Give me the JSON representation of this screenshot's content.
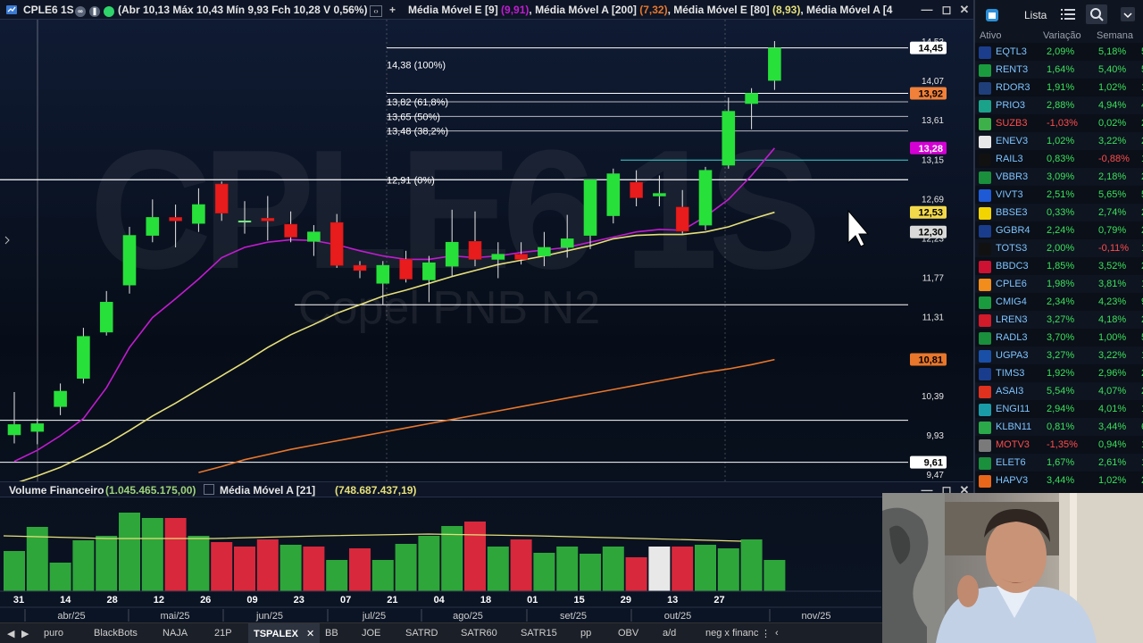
{
  "title_bar": {
    "symbol": "CPLE6 1S",
    "ohlc_text": "(Abr 10,13 Máx 10,43 Mín 9,93 Fch 10,28 V 0,56%)",
    "indicators": [
      {
        "label": "Média Móvel E [9]",
        "value": "(9,91)"
      },
      {
        "label": "Média Móvel A [200]",
        "value": "(7,32)"
      },
      {
        "label": "Média Móvel E [80]",
        "value": "(8,93)"
      },
      {
        "label": "Média Móvel A [4",
        "value": ""
      }
    ]
  },
  "watermark": {
    "ticker": "CPLE6 1S",
    "company": "Copel PNB N2"
  },
  "fibonacci": [
    {
      "label": "14,38 (100%)",
      "price": 14.38
    },
    {
      "label": "13,82 (61,8%)",
      "price": 13.82
    },
    {
      "label": "13,65 (50%)",
      "price": 13.65
    },
    {
      "label": "13,48 (38,2%)",
      "price": 13.48
    },
    {
      "label": "12,91 (0%)",
      "price": 12.91
    }
  ],
  "price_axis": {
    "ticks": [
      "14,53",
      "14,07",
      "13,61",
      "13,15",
      "12,69",
      "12,23",
      "11,77",
      "11,31",
      "10,85",
      "10,39",
      "9,93",
      "9,47"
    ],
    "tick_values": [
      14.53,
      14.07,
      13.61,
      13.15,
      12.69,
      12.23,
      11.77,
      11.31,
      10.85,
      10.39,
      9.93,
      9.47
    ],
    "tags": [
      {
        "label": "14,45",
        "value": 14.45,
        "bg": "#ffffff",
        "fg": "#000000"
      },
      {
        "label": "13,92",
        "value": 13.92,
        "bg": "#f0803a",
        "fg": "#000000"
      },
      {
        "label": "13,28",
        "value": 13.28,
        "bg": "#d400d4",
        "fg": "#ffffff"
      },
      {
        "label": "12,53",
        "value": 12.53,
        "bg": "#f2d94c",
        "fg": "#000000"
      },
      {
        "label": "12,30",
        "value": 12.3,
        "bg": "#d9d9d9",
        "fg": "#000000"
      },
      {
        "label": "10,81",
        "value": 10.81,
        "bg": "#e8762b",
        "fg": "#000000"
      },
      {
        "label": "9,61",
        "value": 9.61,
        "bg": "#ffffff",
        "fg": "#000000"
      }
    ]
  },
  "volume": {
    "label": "Volume Financeiro",
    "value": "(1.045.465.175,00)",
    "ma_label": "Média Móvel A [21]",
    "ma_value": "(748.687.437,19)"
  },
  "time_axis": {
    "days": [
      "31",
      "14",
      "28",
      "12",
      "26",
      "09",
      "23",
      "07",
      "21",
      "04",
      "18",
      "01",
      "15",
      "29",
      "13",
      "27"
    ],
    "months": [
      "abr/25",
      "mai/25",
      "jun/25",
      "jul/25",
      "ago/25",
      "set/25",
      "out/25",
      "nov/25"
    ]
  },
  "chart_data": {
    "type": "candlestick",
    "unit": "BRL",
    "candles": [
      {
        "o": 9.93,
        "h": 10.43,
        "l": 9.83,
        "c": 10.05
      },
      {
        "o": 9.97,
        "h": 10.12,
        "l": 9.82,
        "c": 10.06
      },
      {
        "o": 10.26,
        "h": 10.53,
        "l": 10.16,
        "c": 10.44
      },
      {
        "o": 10.59,
        "h": 11.18,
        "l": 10.53,
        "c": 11.08
      },
      {
        "o": 11.13,
        "h": 11.61,
        "l": 11.09,
        "c": 11.48
      },
      {
        "o": 11.68,
        "h": 12.36,
        "l": 11.58,
        "c": 12.26
      },
      {
        "o": 12.26,
        "h": 12.68,
        "l": 12.18,
        "c": 12.47
      },
      {
        "o": 12.47,
        "h": 12.62,
        "l": 12.12,
        "c": 12.43
      },
      {
        "o": 12.4,
        "h": 12.81,
        "l": 12.3,
        "c": 12.62
      },
      {
        "o": 12.86,
        "h": 12.89,
        "l": 12.43,
        "c": 12.52
      },
      {
        "o": 12.43,
        "h": 12.66,
        "l": 12.28,
        "c": 12.43
      },
      {
        "o": 12.46,
        "h": 12.72,
        "l": 12.2,
        "c": 12.43
      },
      {
        "o": 12.39,
        "h": 12.54,
        "l": 12.18,
        "c": 12.24
      },
      {
        "o": 12.19,
        "h": 12.38,
        "l": 12.02,
        "c": 12.3
      },
      {
        "o": 12.41,
        "h": 12.51,
        "l": 11.88,
        "c": 11.91
      },
      {
        "o": 11.91,
        "h": 11.96,
        "l": 11.76,
        "c": 11.85
      },
      {
        "o": 11.7,
        "h": 11.96,
        "l": 11.45,
        "c": 11.91
      },
      {
        "o": 11.98,
        "h": 12.08,
        "l": 11.71,
        "c": 11.75
      },
      {
        "o": 11.74,
        "h": 12.02,
        "l": 11.48,
        "c": 11.94
      },
      {
        "o": 11.9,
        "h": 12.56,
        "l": 11.78,
        "c": 12.18
      },
      {
        "o": 12.19,
        "h": 12.54,
        "l": 11.9,
        "c": 11.98
      },
      {
        "o": 11.98,
        "h": 12.18,
        "l": 11.76,
        "c": 12.04
      },
      {
        "o": 12.04,
        "h": 12.18,
        "l": 11.92,
        "c": 11.98
      },
      {
        "o": 12.02,
        "h": 12.3,
        "l": 11.9,
        "c": 12.12
      },
      {
        "o": 12.12,
        "h": 12.5,
        "l": 12.0,
        "c": 12.22
      },
      {
        "o": 12.26,
        "h": 12.62,
        "l": 12.1,
        "c": 12.91
      },
      {
        "o": 12.49,
        "h": 13.04,
        "l": 12.4,
        "c": 12.98
      },
      {
        "o": 12.88,
        "h": 13.02,
        "l": 12.6,
        "c": 12.7
      },
      {
        "o": 12.72,
        "h": 12.96,
        "l": 12.6,
        "c": 12.75
      },
      {
        "o": 12.59,
        "h": 12.79,
        "l": 12.28,
        "c": 12.31
      },
      {
        "o": 12.38,
        "h": 13.06,
        "l": 12.32,
        "c": 13.02
      },
      {
        "o": 13.08,
        "h": 13.87,
        "l": 13.04,
        "c": 13.71
      },
      {
        "o": 13.8,
        "h": 13.98,
        "l": 13.5,
        "c": 13.92
      },
      {
        "o": 14.07,
        "h": 14.53,
        "l": 13.96,
        "c": 14.45
      }
    ],
    "series": [
      {
        "name": "Média Móvel E [9]",
        "color": "#c21bd1",
        "values": [
          9.62,
          9.75,
          9.92,
          10.12,
          10.48,
          10.95,
          11.3,
          11.52,
          11.75,
          12.0,
          12.12,
          12.18,
          12.21,
          12.2,
          12.15,
          12.08,
          12.02,
          11.98,
          11.98,
          12.02,
          12.0,
          12.02,
          12.06,
          12.09,
          12.12,
          12.18,
          12.24,
          12.3,
          12.33,
          12.32,
          12.48,
          12.68,
          12.96,
          13.28
        ]
      },
      {
        "name": "Média Móvel E [80]",
        "color": "#e6e07a",
        "values": [
          9.36,
          9.45,
          9.55,
          9.68,
          9.82,
          9.98,
          10.15,
          10.3,
          10.46,
          10.62,
          10.78,
          10.95,
          11.1,
          11.22,
          11.35,
          11.45,
          11.55,
          11.62,
          11.7,
          11.78,
          11.85,
          11.92,
          11.97,
          12.02,
          12.08,
          12.14,
          12.22,
          12.26,
          12.27,
          12.27,
          12.3,
          12.36,
          12.45,
          12.53
        ]
      },
      {
        "name": "Média Móvel A [200]",
        "color": "#e8762b",
        "values": [
          null,
          null,
          null,
          null,
          null,
          null,
          null,
          null,
          9.49,
          9.56,
          9.64,
          9.7,
          9.76,
          9.81,
          9.86,
          9.91,
          9.96,
          10.01,
          10.06,
          10.11,
          10.16,
          10.21,
          10.26,
          10.31,
          10.36,
          10.41,
          10.46,
          10.51,
          10.56,
          10.61,
          10.66,
          10.7,
          10.75,
          10.81
        ]
      }
    ],
    "volume_relative": [
      0.45,
      0.72,
      0.32,
      0.57,
      0.62,
      0.88,
      0.82,
      0.82,
      0.62,
      0.55,
      0.5,
      0.58,
      0.52,
      0.5,
      0.35,
      0.48,
      0.35,
      0.53,
      0.62,
      0.73,
      0.78,
      0.5,
      0.58,
      0.43,
      0.5,
      0.42,
      0.5,
      0.38,
      0.5,
      0.5,
      0.52,
      0.48,
      0.58,
      0.35
    ],
    "volume_colors": [
      "g",
      "g",
      "g",
      "g",
      "g",
      "g",
      "g",
      "r",
      "g",
      "r",
      "r",
      "r",
      "g",
      "r",
      "g",
      "r",
      "g",
      "g",
      "g",
      "g",
      "r",
      "g",
      "r",
      "g",
      "g",
      "g",
      "g",
      "r",
      "w",
      "r",
      "g",
      "g",
      "g",
      "g"
    ],
    "horizontal_lines": [
      14.45,
      13.92,
      13.28,
      12.91,
      11.45,
      10.1,
      9.61
    ]
  },
  "watchlist": {
    "title": "Lista",
    "columns": [
      "Ativo",
      "Variação",
      "Semana"
    ],
    "rows": [
      {
        "ticker": "EQTL3",
        "var": "2,09%",
        "week": "5,18%",
        "extra": "5",
        "icon_color": "#1b3d8c",
        "neg": false
      },
      {
        "ticker": "RENT3",
        "var": "1,64%",
        "week": "5,40%",
        "extra": "5",
        "icon_color": "#1a9c3e",
        "neg": false
      },
      {
        "ticker": "RDOR3",
        "var": "1,91%",
        "week": "1,02%",
        "extra": "1",
        "icon_color": "#1f3f7a",
        "neg": false
      },
      {
        "ticker": "PRIO3",
        "var": "2,88%",
        "week": "4,94%",
        "extra": "4",
        "icon_color": "#1aa38a",
        "neg": false
      },
      {
        "ticker": "SUZB3",
        "var": "-1,03%",
        "week": "0,02%",
        "extra": "2",
        "icon_color": "#3db04a",
        "neg": true
      },
      {
        "ticker": "ENEV3",
        "var": "1,02%",
        "week": "3,22%",
        "extra": "2",
        "icon_color": "#e8e8e8",
        "neg": false
      },
      {
        "ticker": "RAIL3",
        "var": "0,83%",
        "week": "-0,88%",
        "extra": "1",
        "icon_color": "#111111",
        "neg": false,
        "week_neg": true
      },
      {
        "ticker": "VBBR3",
        "var": "3,09%",
        "week": "2,18%",
        "extra": "2",
        "icon_color": "#1a8f3c",
        "neg": false
      },
      {
        "ticker": "VIVT3",
        "var": "2,51%",
        "week": "5,65%",
        "extra": "5",
        "icon_color": "#1e5ad6",
        "neg": false
      },
      {
        "ticker": "BBSE3",
        "var": "0,33%",
        "week": "2,74%",
        "extra": "2",
        "icon_color": "#f2d400",
        "neg": false
      },
      {
        "ticker": "GGBR4",
        "var": "2,24%",
        "week": "0,79%",
        "extra": "2",
        "icon_color": "#1a3c8c",
        "neg": false
      },
      {
        "ticker": "TOTS3",
        "var": "2,00%",
        "week": "-0,11%",
        "extra": "1",
        "icon_color": "#111111",
        "neg": false,
        "week_neg": true
      },
      {
        "ticker": "BBDC3",
        "var": "1,85%",
        "week": "3,52%",
        "extra": "2",
        "icon_color": "#cc1133",
        "neg": false
      },
      {
        "ticker": "CPLE6",
        "var": "1,98%",
        "week": "3,81%",
        "extra": "1",
        "icon_color": "#f28c1a",
        "neg": false
      },
      {
        "ticker": "CMIG4",
        "var": "2,34%",
        "week": "4,23%",
        "extra": "9",
        "icon_color": "#1a9c3e",
        "neg": false
      },
      {
        "ticker": "LREN3",
        "var": "3,27%",
        "week": "4,18%",
        "extra": "2",
        "icon_color": "#d11a2a",
        "neg": false
      },
      {
        "ticker": "RADL3",
        "var": "3,70%",
        "week": "1,00%",
        "extra": "5",
        "icon_color": "#1a8f3c",
        "neg": false
      },
      {
        "ticker": "UGPA3",
        "var": "3,27%",
        "week": "3,22%",
        "extra": "1",
        "icon_color": "#1a4fa8",
        "neg": false
      },
      {
        "ticker": "TIMS3",
        "var": "1,92%",
        "week": "2,96%",
        "extra": "2",
        "icon_color": "#1a3c8c",
        "neg": false
      },
      {
        "ticker": "ASAI3",
        "var": "5,54%",
        "week": "4,07%",
        "extra": "2",
        "icon_color": "#e0301e",
        "neg": false
      },
      {
        "ticker": "ENGI11",
        "var": "2,94%",
        "week": "4,01%",
        "extra": "1",
        "icon_color": "#1a9ca8",
        "neg": false
      },
      {
        "ticker": "KLBN11",
        "var": "0,81%",
        "week": "3,44%",
        "extra": "6",
        "icon_color": "#2aa84a",
        "neg": false
      },
      {
        "ticker": "MOTV3",
        "var": "-1,35%",
        "week": "0,94%",
        "extra": "1",
        "icon_color": "#7a7a7a",
        "neg": true
      },
      {
        "ticker": "ELET6",
        "var": "1,67%",
        "week": "2,61%",
        "extra": "1",
        "icon_color": "#1a8f3c",
        "neg": false
      },
      {
        "ticker": "HAPV3",
        "var": "3,44%",
        "week": "1,02%",
        "extra": "2",
        "icon_color": "#e8661a",
        "neg": false
      }
    ]
  },
  "tabs": {
    "items": [
      "puro",
      "BlackBots",
      "NAJA",
      "21P",
      "TSPALEX",
      "BB",
      "JOE",
      "SATRD",
      "SATR60",
      "SATR15",
      "pp",
      "OBV",
      "a/d",
      "neg x financ"
    ],
    "active": "TSPALEX"
  }
}
